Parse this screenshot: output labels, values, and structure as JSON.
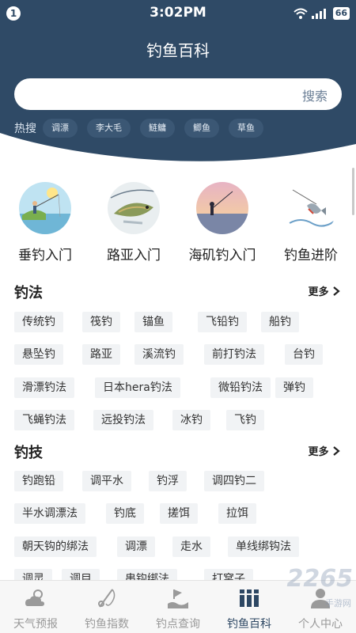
{
  "status_bar": {
    "notification_count": "1",
    "time": "3:02PM",
    "battery": "66"
  },
  "header": {
    "title": "钓鱼百科",
    "bg_color": "#2f4a66"
  },
  "search": {
    "placeholder": "",
    "button_label": "搜索"
  },
  "hot": {
    "label": "热搜",
    "tags": [
      "调漂",
      "李大毛",
      "鲢鳙",
      "鲫鱼",
      "草鱼"
    ]
  },
  "categories": [
    {
      "label": "垂钓入门",
      "icon": "fishing-scene-icon"
    },
    {
      "label": "路亚入门",
      "icon": "lure-fish-icon"
    },
    {
      "label": "海矶钓入门",
      "icon": "sea-sunset-icon"
    },
    {
      "label": "钓鱼进阶",
      "icon": "caught-fish-icon"
    }
  ],
  "sections": {
    "methods": {
      "title": "钓法",
      "more": "更多",
      "items": [
        "传统钓",
        "筏钓",
        "锚鱼",
        "飞铅钓",
        "船钓",
        "悬坠钓",
        "路亚",
        "溪流钓",
        "前打钓法",
        "台钓",
        "滑漂钓法",
        "日本hera钓法",
        "微铅钓法",
        "弹钓",
        "飞蝇钓法",
        "远投钓法",
        "冰钓",
        "飞钓"
      ]
    },
    "skills": {
      "title": "钓技",
      "more": "更多",
      "items": [
        "钓跑铅",
        "调平水",
        "钓浮",
        "调四钓二",
        "半水调漂法",
        "钓底",
        "搓饵",
        "拉饵",
        "朝天钩的绑法",
        "调漂",
        "走水",
        "单线绑钩法",
        "调灵",
        "调目",
        "串钩绑法",
        "打窝子"
      ]
    }
  },
  "bottom_nav": [
    {
      "label": "天气预报",
      "icon": "weather-icon",
      "active": false
    },
    {
      "label": "钓鱼指数",
      "icon": "fishing-rod-icon",
      "active": false
    },
    {
      "label": "钓点查询",
      "icon": "spot-icon",
      "active": false
    },
    {
      "label": "钓鱼百科",
      "icon": "encyclopedia-icon",
      "active": true
    },
    {
      "label": "个人中心",
      "icon": "user-icon",
      "active": false
    }
  ],
  "watermark": {
    "text": "2265",
    "sub": "手游网"
  }
}
